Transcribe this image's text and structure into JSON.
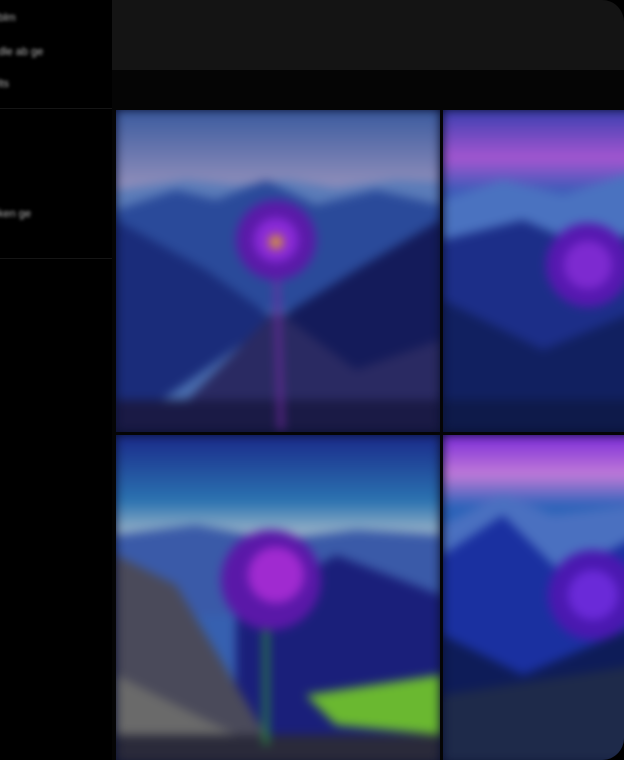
{
  "sidebar": {
    "items": [
      {
        "label": "blm"
      },
      {
        "label": "dle ab ge"
      },
      {
        "label": "lts"
      },
      {
        "label": "ken ge"
      }
    ]
  },
  "gallery": {
    "images": [
      {
        "alt": "purple flower over mountain valley",
        "scene": "flower-valley-1"
      },
      {
        "alt": "purple flower over mountain ridge",
        "scene": "flower-valley-2"
      },
      {
        "alt": "purple flower on rocky slope",
        "scene": "flower-valley-3"
      },
      {
        "alt": "purple flower with snowy peaks",
        "scene": "flower-valley-4"
      }
    ]
  }
}
